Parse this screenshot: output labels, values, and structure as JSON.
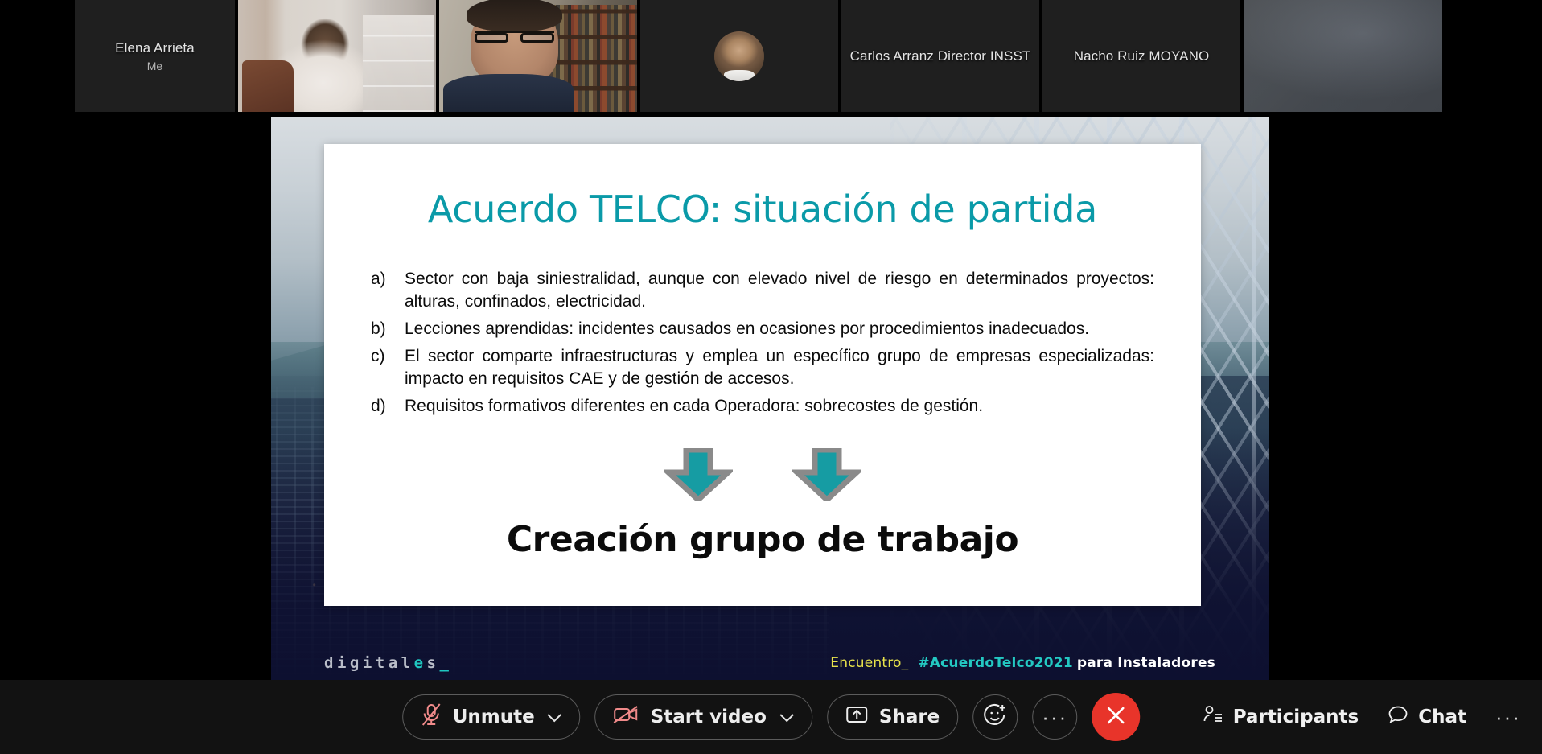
{
  "filmstrip": {
    "tiles": [
      {
        "name": "Elena Arrieta",
        "sub": "Me",
        "kind": "name-only"
      },
      {
        "name": "",
        "sub": "",
        "kind": "video-a"
      },
      {
        "name": "",
        "sub": "",
        "kind": "video-b"
      },
      {
        "name": "",
        "sub": "",
        "kind": "avatar"
      },
      {
        "name": "Carlos Arranz Director INSST",
        "sub": "",
        "kind": "name-only"
      },
      {
        "name": "Nacho Ruiz MOYANO",
        "sub": "",
        "kind": "name-only"
      },
      {
        "name": "",
        "sub": "",
        "kind": "video-grey"
      }
    ]
  },
  "slide": {
    "title": "Acuerdo TELCO: situación de partida",
    "bullets": [
      {
        "mark": "a)",
        "text": "Sector con baja siniestralidad, aunque con elevado nivel de riesgo en determinados proyectos: alturas, confinados, electricidad."
      },
      {
        "mark": "b)",
        "text": "Lecciones aprendidas: incidentes causados en ocasiones por procedimientos inadecuados."
      },
      {
        "mark": "c)",
        "text": "El sector comparte infraestructuras y emplea un específico grupo de empresas especializadas: impacto en requisitos CAE y de gestión de accesos."
      },
      {
        "mark": "d)",
        "text": "Requisitos formativos diferentes en cada Operadora: sobrecostes de gestión."
      }
    ],
    "conclusion": "Creación grupo de trabajo",
    "footer": {
      "logo_pre": "digital",
      "logo_e": "e",
      "logo_post": "s",
      "logo_cursor": "_",
      "encuentro": "Encuentro_",
      "hashtag": "#AcuerdoTelco2021",
      "rest": "para Instaladores"
    },
    "colors": {
      "title_teal": "#0a9aa8",
      "arrow_fill": "#169ca3",
      "arrow_border": "#8a8a8a",
      "footer_yellow": "#e8e34b",
      "footer_teal": "#23c8c2"
    }
  },
  "toolbar": {
    "unmute_label": "Unmute",
    "start_video_label": "Start video",
    "share_label": "Share",
    "participants_label": "Participants",
    "chat_label": "Chat",
    "more_label": "···",
    "more_right_label": "···",
    "leave_label": "✕",
    "leave_color": "#e8342a",
    "muted_icon_color": "#f08a8a"
  }
}
